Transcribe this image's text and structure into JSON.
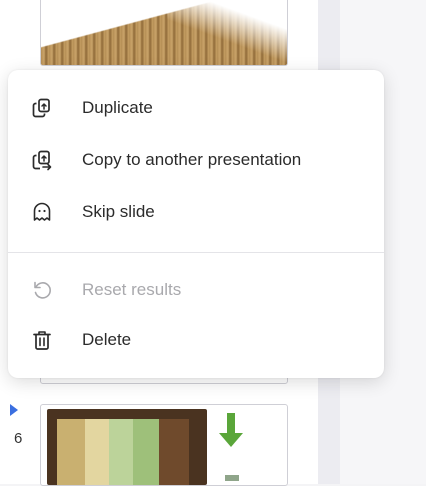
{
  "slides_panel": {
    "current_slide_number": "6"
  },
  "context_menu": {
    "items": [
      {
        "label": "Duplicate",
        "icon": "duplicate-icon",
        "enabled": true
      },
      {
        "label": "Copy to another presentation",
        "icon": "copy-to-presentation-icon",
        "enabled": true
      },
      {
        "label": "Skip slide",
        "icon": "ghost-icon",
        "enabled": true
      },
      {
        "label": "Reset results",
        "icon": "reset-icon",
        "enabled": false
      },
      {
        "label": "Delete",
        "icon": "trash-icon",
        "enabled": true
      }
    ]
  },
  "colors": {
    "text": "#2b2b2b",
    "disabled_text": "#a9a9ad",
    "accent": "#3b6fe0"
  }
}
